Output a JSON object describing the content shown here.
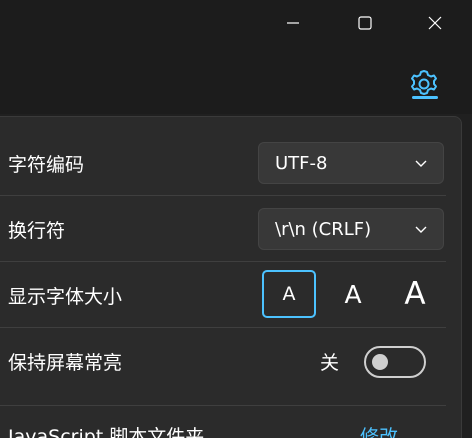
{
  "window": {
    "minimize_label": "—",
    "maximize_label": "□",
    "close_label": "✕"
  },
  "toolbar": {
    "settings_icon": "gear-icon"
  },
  "settings": {
    "encoding": {
      "label": "字符编码",
      "value": "UTF-8"
    },
    "line_ending": {
      "label": "换行符",
      "value": "\\r\\n (CRLF)"
    },
    "font_size": {
      "label": "显示字体大小",
      "options": [
        "A",
        "A",
        "A"
      ],
      "selected_index": 0
    },
    "keep_awake": {
      "label": "保持屏幕常亮",
      "state_text": "关",
      "on": false
    },
    "script_folder": {
      "label": "JavaScript 脚本文件夹",
      "action": "修改"
    }
  },
  "colors": {
    "accent": "#4cc2ff",
    "panel": "#2b2b2b",
    "background": "#202020"
  }
}
